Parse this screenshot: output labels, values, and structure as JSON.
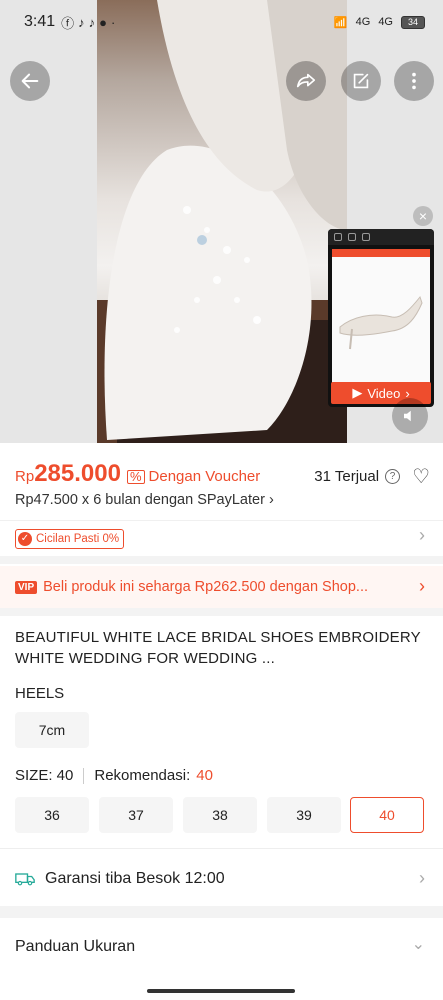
{
  "status_bar": {
    "time": "3:41",
    "battery": "34",
    "network_1": "4G",
    "network_2": "4G"
  },
  "header": {
    "back_icon": "arrow-left-icon",
    "share_icon": "share-icon",
    "edit_icon": "edit-icon",
    "more_icon": "more-vertical-icon"
  },
  "video_widget": {
    "button_label": "Video"
  },
  "price": {
    "currency": "Rp",
    "amount": "285.000",
    "voucher_label": "Dengan Voucher",
    "sold": "31 Terjual",
    "spaylater": "Rp47.500 x 6 bulan dengan SPayLater"
  },
  "cicilan": {
    "label": "Cicilan Pasti 0%"
  },
  "vip": {
    "badge": "VIP",
    "text": "Beli produk ini seharga Rp262.500 dengan Shop..."
  },
  "product": {
    "title": "BEAUTIFUL WHITE LACE BRIDAL SHOES EMBROIDERY WHITE WEDDING FOR WEDDING ..."
  },
  "variants": {
    "heels_label": "HEELS",
    "heels_options": [
      "7cm"
    ],
    "size_label": "SIZE: 40",
    "recommend_label": "Rekomendasi:",
    "recommend_value": "40",
    "size_options": [
      "36",
      "37",
      "38",
      "39",
      "40"
    ],
    "selected_size": "40"
  },
  "shipping": {
    "label": "Garansi tiba Besok 12:00"
  },
  "size_guide": {
    "label": "Panduan Ukuran"
  },
  "colors": {
    "accent": "#ee4d2d"
  }
}
